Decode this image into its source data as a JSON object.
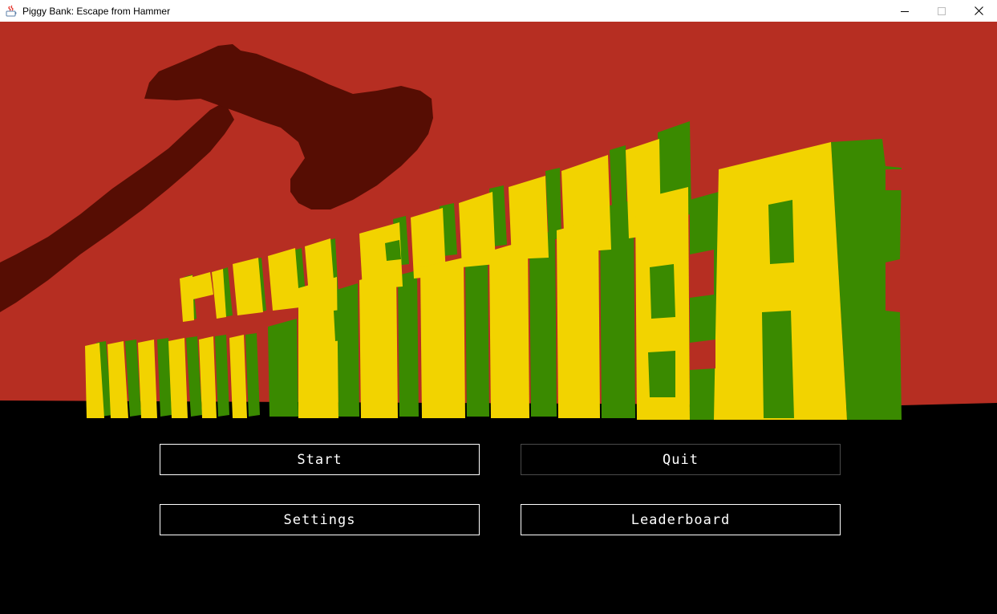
{
  "window": {
    "title": "Piggy Bank: Escape from Hammer",
    "app_icon": "java-icon",
    "controls": {
      "minimize_icon": "minimize-icon",
      "maximize_icon": "maximize-icon",
      "close_icon": "close-icon"
    }
  },
  "game": {
    "logo": {
      "line1": "PIGGY BANK:",
      "line2": "ESCAPE FROM HAMMER",
      "colors": {
        "face": "#f2d300",
        "side": "#3a8a00"
      }
    },
    "background": {
      "sky": "#b62e22",
      "hammer": "#560d03",
      "ground": "#000000"
    },
    "menu": {
      "start": "Start",
      "quit": "Quit",
      "settings": "Settings",
      "leaderboard": "Leaderboard"
    }
  }
}
